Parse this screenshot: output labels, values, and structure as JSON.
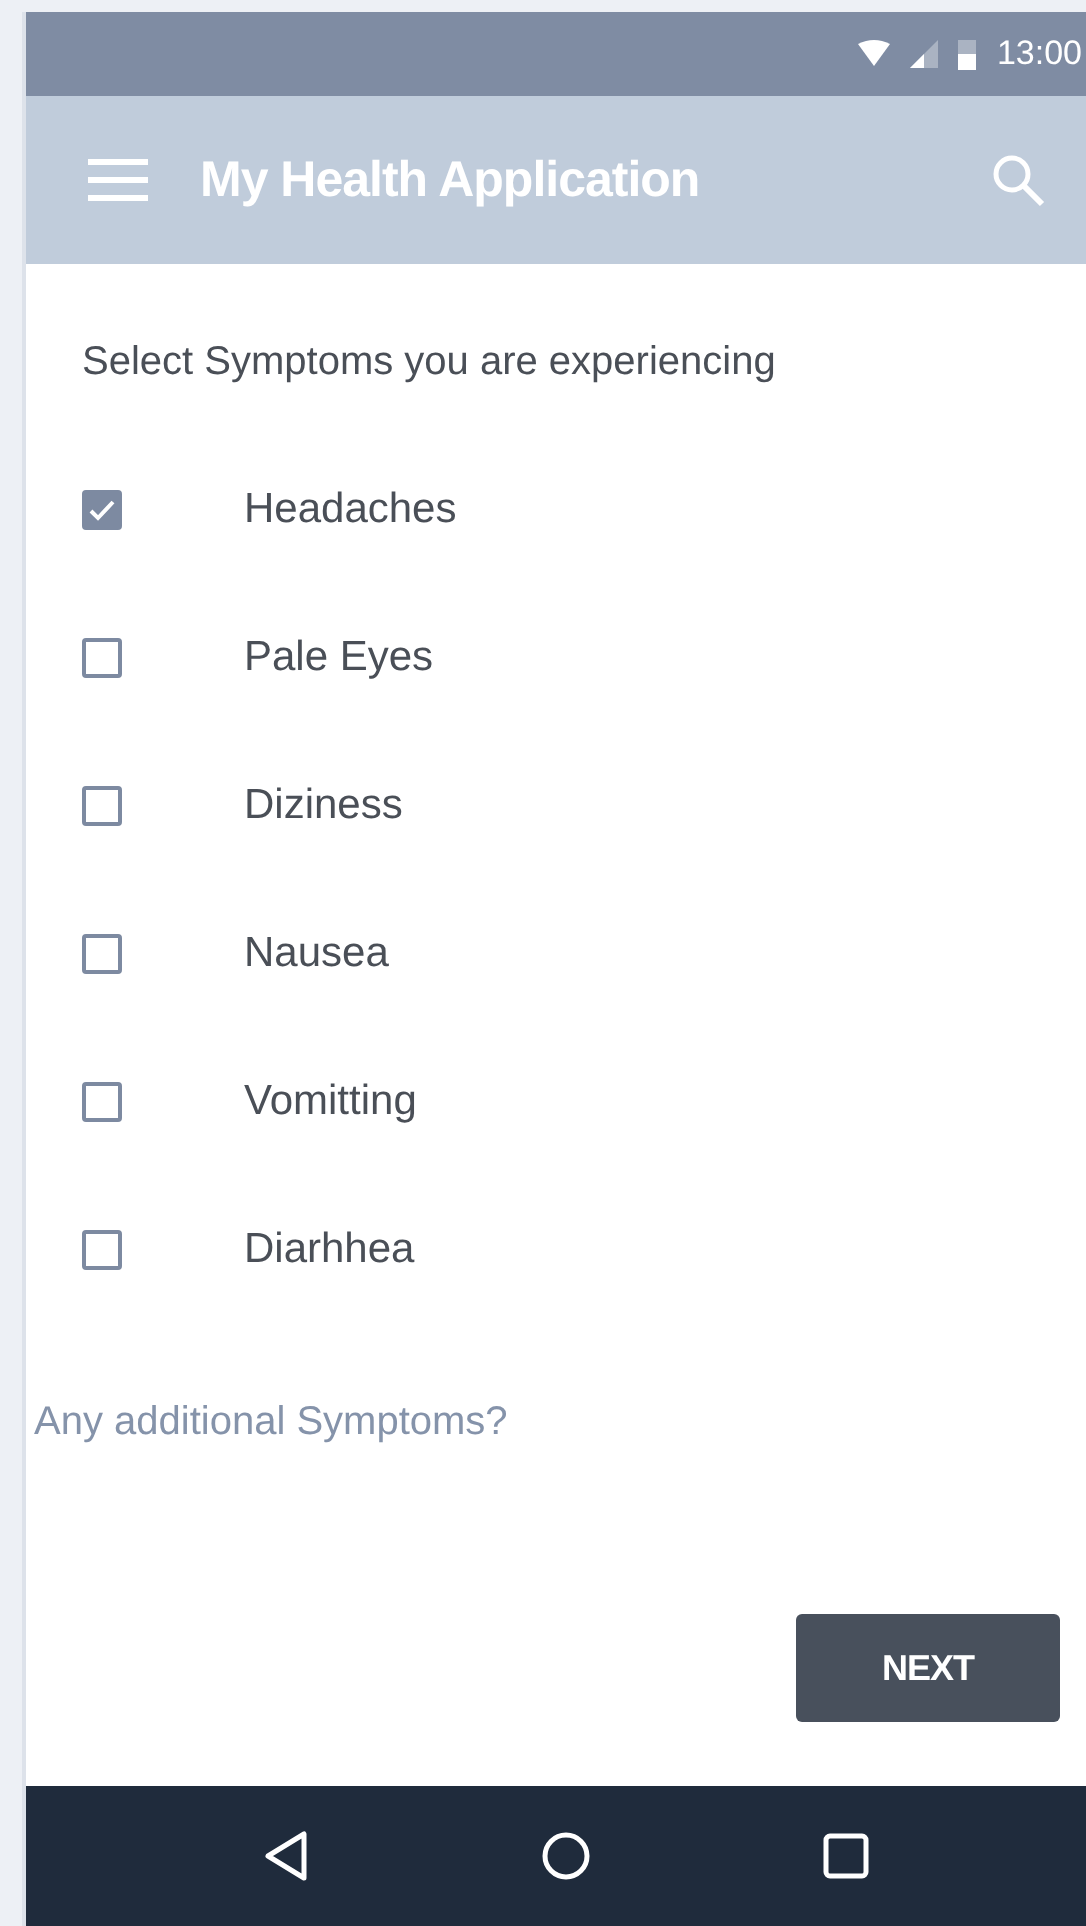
{
  "status_bar": {
    "time": "13:00"
  },
  "app_bar": {
    "title": "My Health Application"
  },
  "prompt": "Select Symptoms you are experiencing",
  "symptoms": [
    {
      "label": "Headaches",
      "checked": true
    },
    {
      "label": "Pale Eyes",
      "checked": false
    },
    {
      "label": "Diziness",
      "checked": false
    },
    {
      "label": "Nausea",
      "checked": false
    },
    {
      "label": "Vomitting",
      "checked": false
    },
    {
      "label": "Diarhhea",
      "checked": false
    }
  ],
  "additional_link": "Any additional Symptoms?",
  "next_button": "NEXT"
}
